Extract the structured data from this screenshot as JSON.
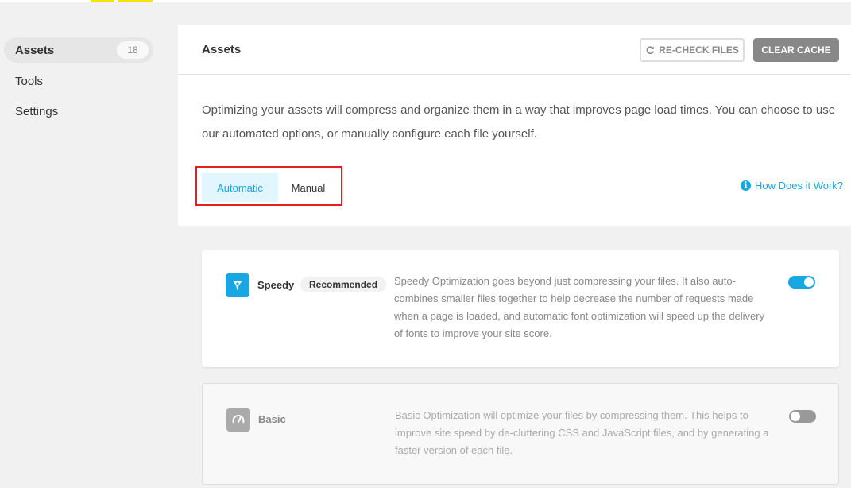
{
  "sidebar": {
    "items": [
      {
        "label": "Assets",
        "badge": "18"
      },
      {
        "label": "Tools"
      },
      {
        "label": "Settings"
      }
    ]
  },
  "header": {
    "title": "Assets",
    "recheck_label": "RE-CHECK FILES",
    "clear_label": "CLEAR CACHE"
  },
  "description": "Optimizing your assets will compress and organize them in a way that improves page load times. You can choose to use our automated options, or manually configure each file yourself.",
  "tabs": {
    "automatic": "Automatic",
    "manual": "Manual"
  },
  "help_link": "How Does it Work?",
  "cards": {
    "speedy": {
      "name": "Speedy",
      "badge": "Recommended",
      "description": "Speedy Optimization goes beyond just compressing your files. It also auto-combines smaller files together to help decrease the number of requests made when a page is loaded, and automatic font optimization will speed up the delivery of fonts to improve your site score.",
      "enabled": true
    },
    "basic": {
      "name": "Basic",
      "description": "Basic Optimization will optimize your files by compressing them. This helps to improve site speed by de-cluttering CSS and JavaScript files, and by generating a faster version of each file.",
      "enabled": false
    }
  },
  "colors": {
    "accent": "#17a8e3",
    "highlight_frame": "#e02020"
  }
}
